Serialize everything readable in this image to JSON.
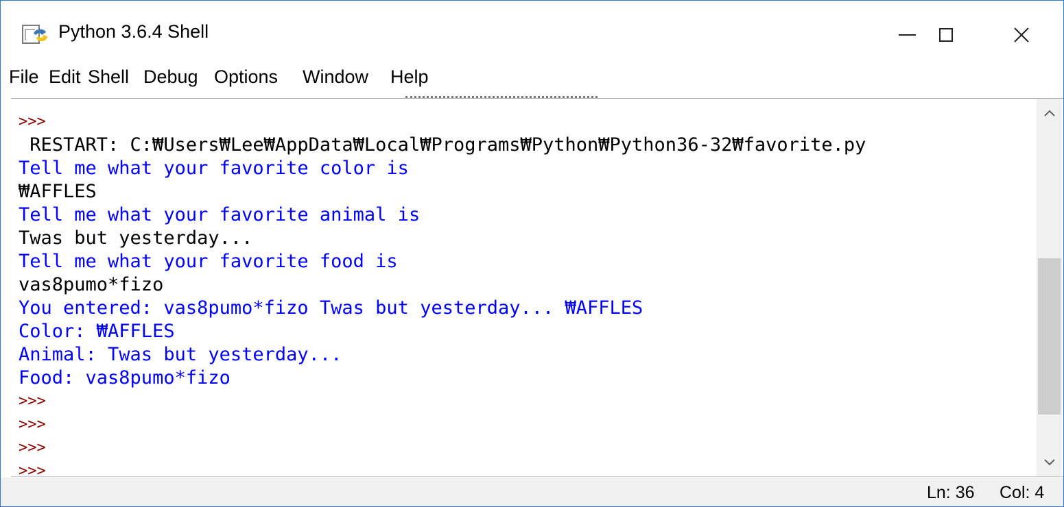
{
  "window": {
    "title": "Python 3.6.4 Shell",
    "icon": "python-idle-icon",
    "controls": {
      "minimize": "minimize-icon",
      "maximize": "maximize-icon",
      "close": "✕"
    }
  },
  "menubar": {
    "items": [
      {
        "label": "File"
      },
      {
        "label": "Edit"
      },
      {
        "label": "Shell"
      },
      {
        "label": "Debug"
      },
      {
        "label": "Options"
      },
      {
        "label": "Window"
      },
      {
        "label": "Help"
      }
    ]
  },
  "shell": {
    "lines": [
      {
        "type": "prompt",
        "text": ">>>"
      },
      {
        "type": "restart",
        "text": " RESTART: C:₩Users₩Lee₩AppData₩Local₩Programs₩Python₩Python36-32₩favorite.py"
      },
      {
        "type": "stdout",
        "text": "Tell me what your favorite color is"
      },
      {
        "type": "input",
        "text": "₩AFFLES"
      },
      {
        "type": "stdout",
        "text": "Tell me what your favorite animal is"
      },
      {
        "type": "input",
        "text": "Twas but yesterday..."
      },
      {
        "type": "stdout",
        "text": "Tell me what your favorite food is"
      },
      {
        "type": "input",
        "text": "vas8pumo*fizo"
      },
      {
        "type": "stdout",
        "text": "You entered: vas8pumo*fizo Twas but yesterday... ₩AFFLES"
      },
      {
        "type": "stdout",
        "text": "Color: ₩AFFLES"
      },
      {
        "type": "stdout",
        "text": "Animal: Twas but yesterday..."
      },
      {
        "type": "stdout",
        "text": "Food: vas8pumo*fizo"
      },
      {
        "type": "prompt",
        "text": ">>>"
      },
      {
        "type": "prompt",
        "text": ">>>"
      },
      {
        "type": "prompt",
        "text": ">>>"
      },
      {
        "type": "prompt",
        "text": ">>>"
      }
    ],
    "colors": {
      "prompt": "#8b0000",
      "stdout": "#0000ff",
      "input": "#000000"
    }
  },
  "scrollbar": {
    "up": "▲",
    "down": "▼"
  },
  "status": {
    "ln": "Ln: 36",
    "col": "Col: 4"
  }
}
